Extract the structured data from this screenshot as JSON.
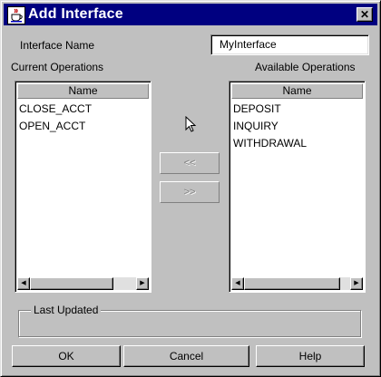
{
  "window": {
    "title": "Add Interface",
    "app_icon": "java-coffee-cup-icon",
    "close_glyph": "✕"
  },
  "form": {
    "interface_name_label": "Interface Name",
    "interface_name_value": "MyInterface"
  },
  "current_operations": {
    "label": "Current Operations",
    "column_header": "Name",
    "items": [
      "CLOSE_ACCT",
      "OPEN_ACCT"
    ]
  },
  "available_operations": {
    "label": "Available Operations",
    "column_header": "Name",
    "items": [
      "DEPOSIT",
      "INQUIRY",
      "WITHDRAWAL"
    ]
  },
  "move_buttons": {
    "add_label": "<<",
    "remove_label": ">>"
  },
  "last_updated": {
    "label": "Last Updated",
    "value": ""
  },
  "buttons": {
    "ok": "OK",
    "cancel": "Cancel",
    "help": "Help"
  },
  "scrollbar": {
    "left_arrow": "◀",
    "right_arrow": "▶"
  }
}
